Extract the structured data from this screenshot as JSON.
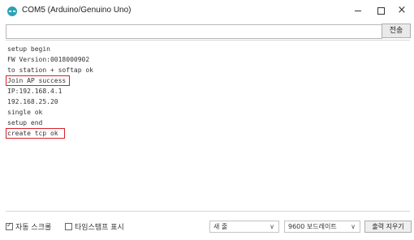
{
  "window": {
    "title": "COM5 (Arduino/Genuino Uno)",
    "minimize_icon": "minimize-icon",
    "maximize_icon": "maximize-icon",
    "close_label": "×"
  },
  "send": {
    "input_value": "",
    "button_label": "전송"
  },
  "output": {
    "lines": [
      "setup begin",
      "FW Version:0018000902",
      "to station + softap ok",
      "Join AP success",
      "IP:192.168.4.1",
      "192.168.25.20",
      "single ok",
      "setup end",
      "create tcp ok"
    ],
    "highlighted_lines": [
      "Join AP success",
      "create tcp ok"
    ],
    "highlight_color": "#d8202a"
  },
  "bottom": {
    "autoscroll_label": "자동 스크롤",
    "autoscroll_checked": true,
    "timestamp_label": "타임스탬프 표시",
    "timestamp_checked": false,
    "line_ending": "새 줄",
    "baud_rate": "9600 보드레이트",
    "clear_label": "출력 지우기"
  }
}
